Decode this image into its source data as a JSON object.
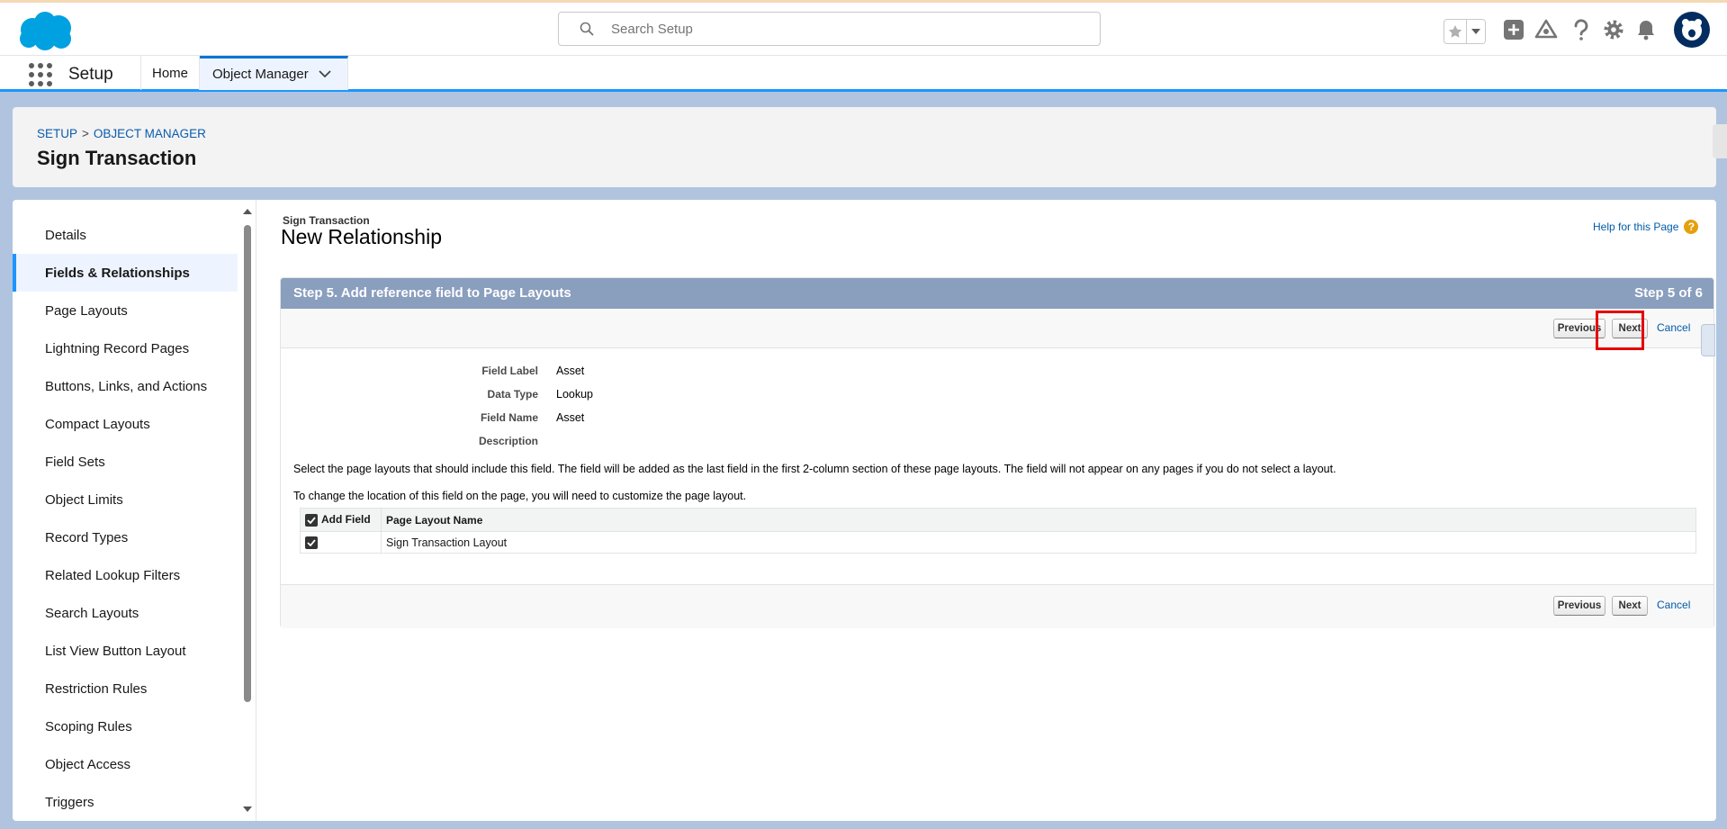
{
  "header": {
    "search_placeholder": "Search Setup",
    "icons": [
      "favorites-star-icon",
      "favorites-dropdown-icon",
      "global-actions-icon",
      "trailhead-guidance-icon",
      "help-icon",
      "setup-gear-icon",
      "notifications-bell-icon",
      "user-avatar-icon"
    ]
  },
  "context_bar": {
    "app_name": "Setup",
    "tabs": [
      {
        "label": "Home"
      },
      {
        "label": "Object Manager"
      }
    ]
  },
  "page_header": {
    "breadcrumb": [
      "SETUP",
      "OBJECT MANAGER"
    ],
    "breadcrumb_separator": ">",
    "title": "Sign Transaction"
  },
  "sidebar": {
    "active_index": 1,
    "items": [
      {
        "label": "Details"
      },
      {
        "label": "Fields & Relationships"
      },
      {
        "label": "Page Layouts"
      },
      {
        "label": "Lightning Record Pages"
      },
      {
        "label": "Buttons, Links, and Actions"
      },
      {
        "label": "Compact Layouts"
      },
      {
        "label": "Field Sets"
      },
      {
        "label": "Object Limits"
      },
      {
        "label": "Record Types"
      },
      {
        "label": "Related Lookup Filters"
      },
      {
        "label": "Search Layouts"
      },
      {
        "label": "List View Button Layout"
      },
      {
        "label": "Restriction Rules"
      },
      {
        "label": "Scoping Rules"
      },
      {
        "label": "Object Access"
      },
      {
        "label": "Triggers"
      }
    ]
  },
  "content": {
    "object_name": "Sign Transaction",
    "page_title": "New Relationship",
    "help_link": "Help for this Page",
    "help_icon": "?",
    "step_title": "Step 5. Add reference field to Page Layouts",
    "step_count": "Step 5 of 6",
    "buttons": {
      "previous": "Previous",
      "next": "Next",
      "cancel": "Cancel"
    },
    "fields": [
      {
        "label": "Field Label",
        "value": "Asset"
      },
      {
        "label": "Data Type",
        "value": "Lookup"
      },
      {
        "label": "Field Name",
        "value": "Asset"
      },
      {
        "label": "Description",
        "value": ""
      }
    ],
    "instruction_1": "Select the page layouts that should include this field. The field will be added as the last field in the first 2-column section of these page layouts. The field will not appear on any pages if you do not select a layout.",
    "instruction_2": "To change the location of this field on the page, you will need to customize the page layout.",
    "table": {
      "headers": [
        "Add Field",
        "Page Layout Name"
      ],
      "rows": [
        {
          "checked": true,
          "layout": "Sign Transaction Layout"
        }
      ]
    }
  },
  "colors": {
    "brand_blue": "#0176d3",
    "step_bar": "#8a9ebe",
    "link": "#015ba7",
    "highlight_red": "#e50000"
  }
}
